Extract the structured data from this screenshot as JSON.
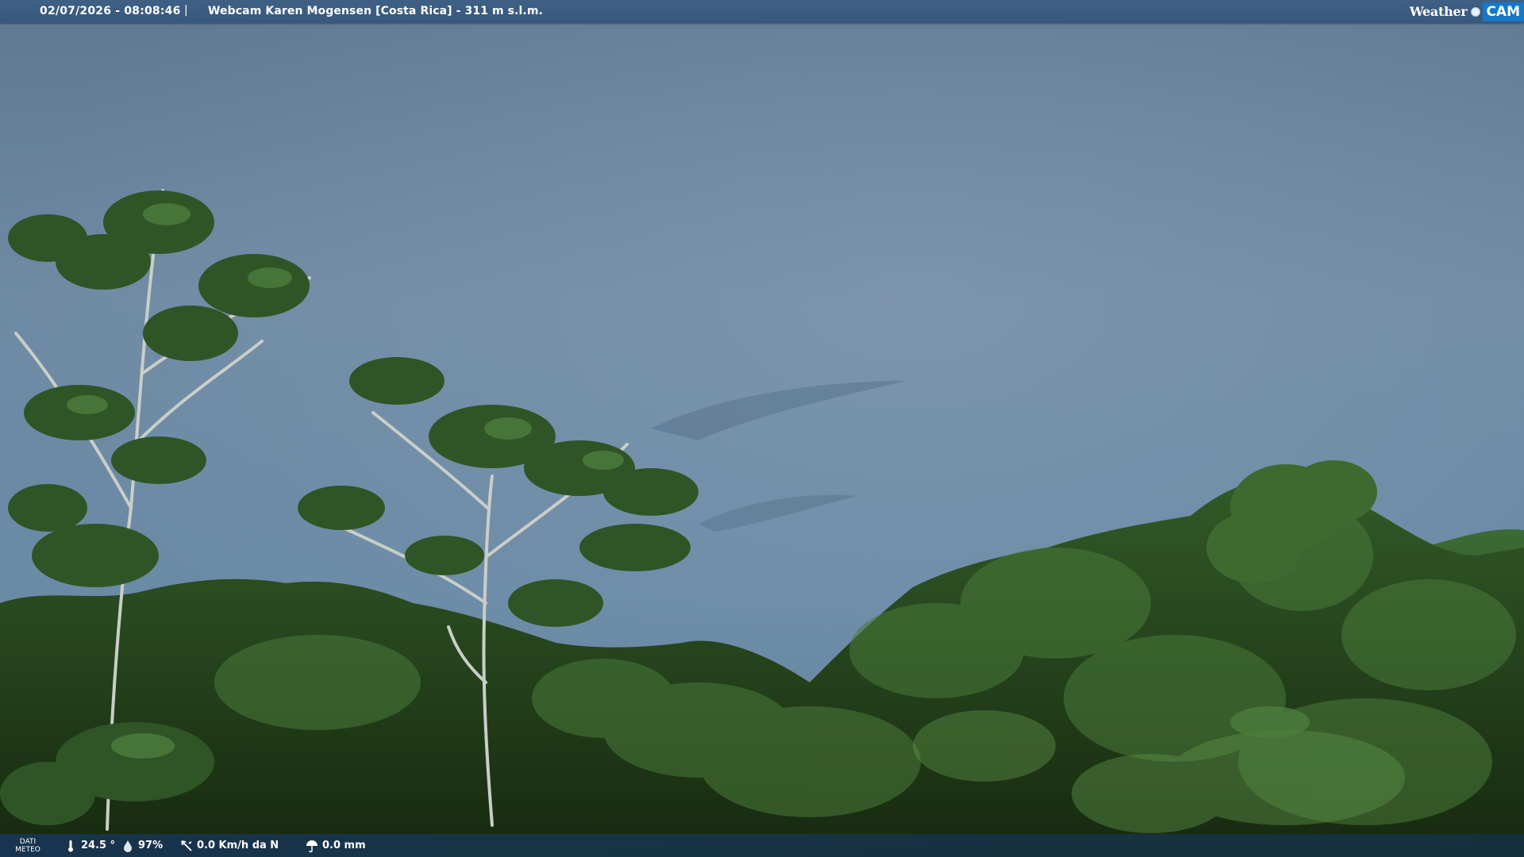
{
  "header": {
    "datetime": "02/07/2026 - 08:08:46",
    "separator": "|",
    "title": "Webcam Karen Mogensen [Costa Rica]  - 311 m s.l.m."
  },
  "logo": {
    "weather_text": "Weather",
    "cam_text": "CAM"
  },
  "weather": {
    "label_line1": "DATI",
    "label_line2": "METEO",
    "temperature": "24.5 °",
    "humidity": "97%",
    "wind": "0.0 Km/h da N",
    "rain": "0.0 mm"
  },
  "icons": {
    "temperature": "thermometer-icon",
    "humidity": "humidity-drop-icon",
    "wind": "wind-vane-icon",
    "rain": "rain-umbrella-icon"
  },
  "colors": {
    "topbar": "#3f5f84",
    "logo_accent": "#1479c9",
    "sky": "#6d87a0",
    "foliage": "#2c4d20"
  }
}
